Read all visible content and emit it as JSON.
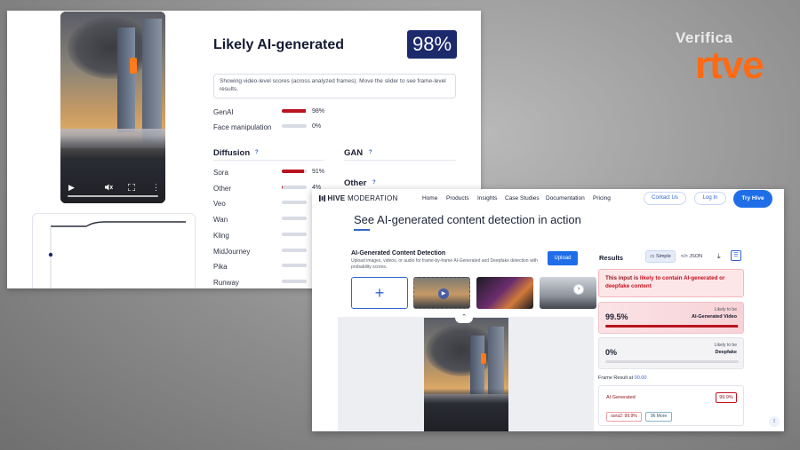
{
  "watermark": {
    "line1": "Verifica",
    "line2": "rtve"
  },
  "shot1": {
    "title": "Likely AI-generated",
    "score": "98%",
    "info": "Showing video-level scores (across analyzed frames). Move the slider to see frame-level results.",
    "top_rows": [
      {
        "label": "GenAI",
        "pct": "98%",
        "value": 0.98
      },
      {
        "label": "Face manipulation",
        "pct": "0%",
        "value": 0.0
      }
    ],
    "sections": {
      "diffusion": "Diffusion",
      "gan": "GAN",
      "other": "Other",
      "help": "?"
    },
    "diffusion_rows": [
      {
        "label": "Sora",
        "pct": "91%",
        "value": 0.91
      },
      {
        "label": "Other",
        "pct": "4%",
        "value": 0.04
      },
      {
        "label": "Veo",
        "pct": "",
        "value": 0.0
      },
      {
        "label": "Wan",
        "pct": "",
        "value": 0.0
      },
      {
        "label": "Kling",
        "pct": "",
        "value": 0.0
      },
      {
        "label": "MidJourney",
        "pct": "",
        "value": 0.0
      },
      {
        "label": "Pika",
        "pct": "",
        "value": 0.0
      },
      {
        "label": "Runway",
        "pct": "",
        "value": 0.0
      }
    ],
    "colors": {
      "bar": "#b8141f",
      "score_bg": "#1c2a6b"
    }
  },
  "shot2": {
    "logo": {
      "brand": "HIVE",
      "product": "MODERATION"
    },
    "nav": [
      "Home",
      "Products",
      "Insights",
      "Case Studies",
      "Documentation",
      "Pricing"
    ],
    "buttons": {
      "contact": "Contact Us",
      "login": "Log In",
      "try": "Try Hive"
    },
    "headline": "See AI-generated content detection in action",
    "detector": {
      "title": "AI-Generated Content Detection",
      "desc": "Upload images, videos, or audio for frame-by-frame AI-Generated and Deepfake detection with probability scores.",
      "upload": "Upload",
      "add": "+"
    },
    "results": {
      "label": "Results",
      "tab_simple": "Simple",
      "tab_json": "</> JSON",
      "alert_prefix": "This input is ",
      "alert_bold": "likely to contain AI-generated or deepfake content",
      "cards": [
        {
          "pct": "99.5%",
          "likely": "Likely to be",
          "type": "AI-Generated Video",
          "value": 0.995
        },
        {
          "pct": "0%",
          "likely": "Likely to be",
          "type": "Deepfake",
          "value": 0.0
        }
      ],
      "frame_result_label": "Frame Result at ",
      "frame_result_time": "00.00",
      "frame": {
        "class": "AI Generated",
        "score": "99.9%",
        "sora": "sora2: 99.9%",
        "more": "96 More"
      }
    },
    "colors": {
      "accent": "#1f6ee8",
      "danger": "#c3121f"
    }
  }
}
